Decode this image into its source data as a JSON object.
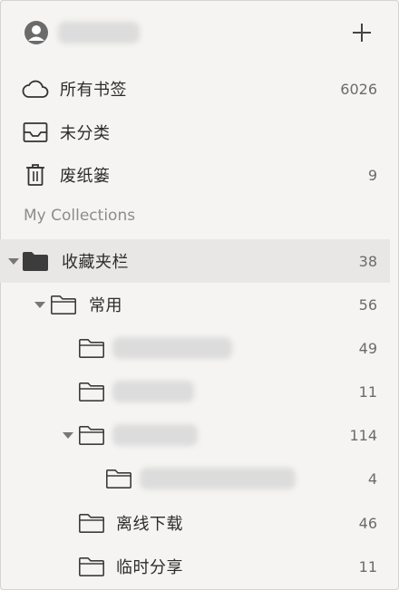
{
  "account": {
    "name": "",
    "add_icon": "plus-icon",
    "avatar_icon": "user-avatar-icon"
  },
  "nav": {
    "all_bookmarks": {
      "label": "所有书签",
      "count": "6026"
    },
    "unsorted": {
      "label": "未分类"
    },
    "trash": {
      "label": "废纸篓",
      "count": "9"
    }
  },
  "collections": {
    "section_title": "My Collections",
    "favorites": {
      "label": "收藏夹栏",
      "count": "38"
    },
    "common": {
      "label": "常用",
      "count": "56"
    },
    "sub1": {
      "count": "49"
    },
    "sub2": {
      "count": "11"
    },
    "sub3": {
      "count": "114"
    },
    "sub3a": {
      "count": "4"
    },
    "offline": {
      "label": "离线下载",
      "count": "46"
    },
    "temp_share": {
      "label": "临时分享",
      "count": "11"
    }
  },
  "colors": {
    "background": "#f5f4f2",
    "selected": "#e8e7e5",
    "folder_dark": "#3c3c3c"
  }
}
